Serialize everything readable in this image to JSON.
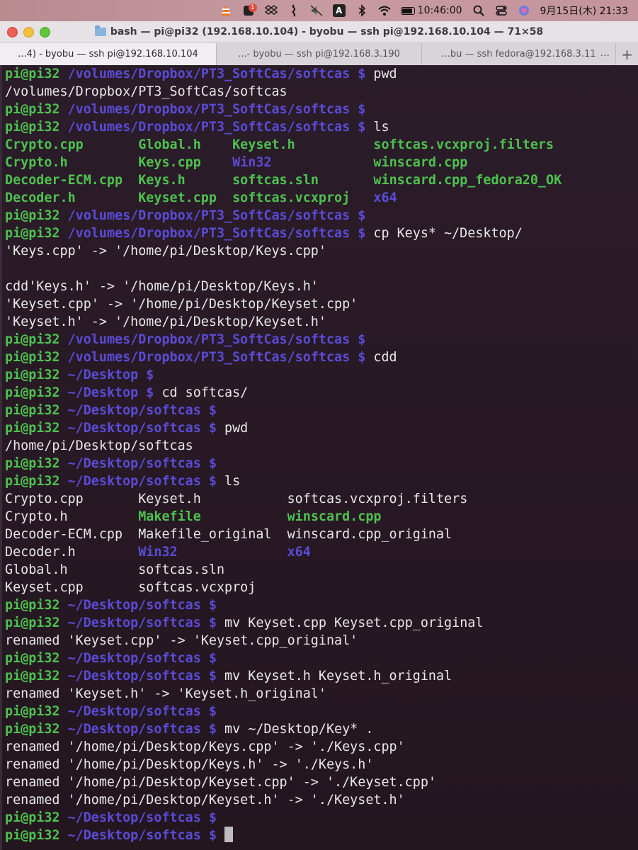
{
  "menubar": {
    "items": [
      {
        "icon": "vlc-icon"
      },
      {
        "icon": "notification-app-icon",
        "badge": "1"
      },
      {
        "icon": "dropbox-icon"
      },
      {
        "icon": "wavelength-icon"
      },
      {
        "icon": "mute-icon"
      },
      {
        "icon": "input-source-icon",
        "label": "A"
      },
      {
        "icon": "bluetooth-icon"
      },
      {
        "icon": "wifi-icon"
      }
    ],
    "battery_time": "10:46:00",
    "battery_level": 0.9,
    "date_time": "9月15日(木)  21:33"
  },
  "window": {
    "title": "bash — pi@pi32 (192.168.10.104) - byobu — ssh pi@192.168.10.104 — 71×58",
    "tabs": [
      {
        "label": "...4) - byobu — ssh pi@192.168.10.104",
        "active": true
      },
      {
        "label": "...- byobu — ssh pi@192.168.3.190",
        "active": false
      },
      {
        "label": "...bu — ssh fedora@192.168.3.11",
        "active": false
      }
    ],
    "tab_add_label": "+",
    "tab_more_label": "..."
  },
  "terminal": {
    "lines": [
      [
        {
          "t": "pi@pi32 ",
          "c": "p-user"
        },
        {
          "t": "/volumes/Dropbox/PT3_SoftCas/softcas $ ",
          "c": "p-path"
        },
        {
          "t": "pwd",
          "c": "out"
        }
      ],
      [
        {
          "t": "/volumes/Dropbox/PT3_SoftCas/softcas",
          "c": "out"
        }
      ],
      [
        {
          "t": "pi@pi32 ",
          "c": "p-user"
        },
        {
          "t": "/volumes/Dropbox/PT3_SoftCas/softcas $",
          "c": "p-path"
        }
      ],
      [
        {
          "t": "pi@pi32 ",
          "c": "p-user"
        },
        {
          "t": "/volumes/Dropbox/PT3_SoftCas/softcas $ ",
          "c": "p-path"
        },
        {
          "t": "ls",
          "c": "out"
        }
      ],
      [
        {
          "t": "Crypto.cpp       ",
          "c": "c-green"
        },
        {
          "t": "Global.h    ",
          "c": "c-green"
        },
        {
          "t": "Keyset.h          ",
          "c": "c-green"
        },
        {
          "t": "softcas.vcxproj.filters",
          "c": "c-green"
        }
      ],
      [
        {
          "t": "Crypto.h         ",
          "c": "c-green"
        },
        {
          "t": "Keys.cpp    ",
          "c": "c-green"
        },
        {
          "t": "Win32             ",
          "c": "c-blue"
        },
        {
          "t": "winscard.cpp",
          "c": "c-green"
        }
      ],
      [
        {
          "t": "Decoder-ECM.cpp  ",
          "c": "c-green"
        },
        {
          "t": "Keys.h      ",
          "c": "c-green"
        },
        {
          "t": "softcas.sln       ",
          "c": "c-green"
        },
        {
          "t": "winscard.cpp_fedora20_OK",
          "c": "c-green"
        }
      ],
      [
        {
          "t": "Decoder.h        ",
          "c": "c-green"
        },
        {
          "t": "Keyset.cpp  ",
          "c": "c-green"
        },
        {
          "t": "softcas.vcxproj   ",
          "c": "c-green"
        },
        {
          "t": "x64",
          "c": "c-blue"
        }
      ],
      [
        {
          "t": "pi@pi32 ",
          "c": "p-user"
        },
        {
          "t": "/volumes/Dropbox/PT3_SoftCas/softcas $",
          "c": "p-path"
        }
      ],
      [
        {
          "t": "pi@pi32 ",
          "c": "p-user"
        },
        {
          "t": "/volumes/Dropbox/PT3_SoftCas/softcas $ ",
          "c": "p-path"
        },
        {
          "t": "cp Keys* ~/Desktop/",
          "c": "out"
        }
      ],
      [
        {
          "t": "'Keys.cpp' -> '/home/pi/Desktop/Keys.cpp'",
          "c": "out"
        }
      ],
      [
        {
          "t": "",
          "c": "out"
        }
      ],
      [
        {
          "t": "cdd'Keys.h' -> '/home/pi/Desktop/Keys.h'",
          "c": "out"
        }
      ],
      [
        {
          "t": "'Keyset.cpp' -> '/home/pi/Desktop/Keyset.cpp'",
          "c": "out"
        }
      ],
      [
        {
          "t": "'Keyset.h' -> '/home/pi/Desktop/Keyset.h'",
          "c": "out"
        }
      ],
      [
        {
          "t": "pi@pi32 ",
          "c": "p-user"
        },
        {
          "t": "/volumes/Dropbox/PT3_SoftCas/softcas $",
          "c": "p-path"
        }
      ],
      [
        {
          "t": "pi@pi32 ",
          "c": "p-user"
        },
        {
          "t": "/volumes/Dropbox/PT3_SoftCas/softcas $ ",
          "c": "p-path"
        },
        {
          "t": "cdd",
          "c": "out"
        }
      ],
      [
        {
          "t": "pi@pi32 ",
          "c": "p-user"
        },
        {
          "t": "~/Desktop $",
          "c": "p-path"
        }
      ],
      [
        {
          "t": "pi@pi32 ",
          "c": "p-user"
        },
        {
          "t": "~/Desktop $ ",
          "c": "p-path"
        },
        {
          "t": "cd softcas/",
          "c": "out"
        }
      ],
      [
        {
          "t": "pi@pi32 ",
          "c": "p-user"
        },
        {
          "t": "~/Desktop/softcas $",
          "c": "p-path"
        }
      ],
      [
        {
          "t": "pi@pi32 ",
          "c": "p-user"
        },
        {
          "t": "~/Desktop/softcas $ ",
          "c": "p-path"
        },
        {
          "t": "pwd",
          "c": "out"
        }
      ],
      [
        {
          "t": "/home/pi/Desktop/softcas",
          "c": "out"
        }
      ],
      [
        {
          "t": "pi@pi32 ",
          "c": "p-user"
        },
        {
          "t": "~/Desktop/softcas $",
          "c": "p-path"
        }
      ],
      [
        {
          "t": "pi@pi32 ",
          "c": "p-user"
        },
        {
          "t": "~/Desktop/softcas $ ",
          "c": "p-path"
        },
        {
          "t": "ls",
          "c": "out"
        }
      ],
      [
        {
          "t": "Crypto.cpp       ",
          "c": "out"
        },
        {
          "t": "Keyset.h           ",
          "c": "out"
        },
        {
          "t": "softcas.vcxproj.filters",
          "c": "out"
        }
      ],
      [
        {
          "t": "Crypto.h         ",
          "c": "out"
        },
        {
          "t": "Makefile           ",
          "c": "c-green"
        },
        {
          "t": "winscard.cpp",
          "c": "c-green"
        }
      ],
      [
        {
          "t": "Decoder-ECM.cpp  ",
          "c": "out"
        },
        {
          "t": "Makefile_original  ",
          "c": "out"
        },
        {
          "t": "winscard.cpp_original",
          "c": "out"
        }
      ],
      [
        {
          "t": "Decoder.h        ",
          "c": "out"
        },
        {
          "t": "Win32              ",
          "c": "c-blue"
        },
        {
          "t": "x64",
          "c": "c-blue"
        }
      ],
      [
        {
          "t": "Global.h         ",
          "c": "out"
        },
        {
          "t": "softcas.sln",
          "c": "out"
        }
      ],
      [
        {
          "t": "Keyset.cpp       ",
          "c": "out"
        },
        {
          "t": "softcas.vcxproj",
          "c": "out"
        }
      ],
      [
        {
          "t": "pi@pi32 ",
          "c": "p-user"
        },
        {
          "t": "~/Desktop/softcas $",
          "c": "p-path"
        }
      ],
      [
        {
          "t": "pi@pi32 ",
          "c": "p-user"
        },
        {
          "t": "~/Desktop/softcas $ ",
          "c": "p-path"
        },
        {
          "t": "mv Keyset.cpp Keyset.cpp_original",
          "c": "out"
        }
      ],
      [
        {
          "t": "renamed 'Keyset.cpp' -> 'Keyset.cpp_original'",
          "c": "out"
        }
      ],
      [
        {
          "t": "pi@pi32 ",
          "c": "p-user"
        },
        {
          "t": "~/Desktop/softcas $",
          "c": "p-path"
        }
      ],
      [
        {
          "t": "pi@pi32 ",
          "c": "p-user"
        },
        {
          "t": "~/Desktop/softcas $ ",
          "c": "p-path"
        },
        {
          "t": "mv Keyset.h Keyset.h_original",
          "c": "out"
        }
      ],
      [
        {
          "t": "renamed 'Keyset.h' -> 'Keyset.h_original'",
          "c": "out"
        }
      ],
      [
        {
          "t": "pi@pi32 ",
          "c": "p-user"
        },
        {
          "t": "~/Desktop/softcas $",
          "c": "p-path"
        }
      ],
      [
        {
          "t": "pi@pi32 ",
          "c": "p-user"
        },
        {
          "t": "~/Desktop/softcas $ ",
          "c": "p-path"
        },
        {
          "t": "mv ~/Desktop/Key* .",
          "c": "out"
        }
      ],
      [
        {
          "t": "renamed '/home/pi/Desktop/Keys.cpp' -> './Keys.cpp'",
          "c": "out"
        }
      ],
      [
        {
          "t": "renamed '/home/pi/Desktop/Keys.h' -> './Keys.h'",
          "c": "out"
        }
      ],
      [
        {
          "t": "renamed '/home/pi/Desktop/Keyset.cpp' -> './Keyset.cpp'",
          "c": "out"
        }
      ],
      [
        {
          "t": "renamed '/home/pi/Desktop/Keyset.h' -> './Keyset.h'",
          "c": "out"
        }
      ],
      [
        {
          "t": "pi@pi32 ",
          "c": "p-user"
        },
        {
          "t": "~/Desktop/softcas $",
          "c": "p-path"
        }
      ],
      [
        {
          "t": "pi@pi32 ",
          "c": "p-user"
        },
        {
          "t": "~/Desktop/softcas $ ",
          "c": "p-path"
        }
      ]
    ],
    "cursor_on_last_line": true
  }
}
